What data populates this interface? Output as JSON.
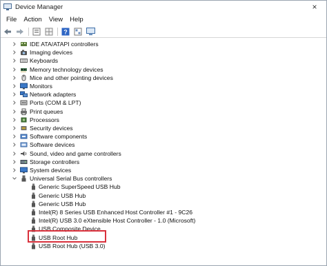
{
  "window": {
    "title": "Device Manager",
    "close_glyph": "×"
  },
  "menu": {
    "items": [
      "File",
      "Action",
      "View",
      "Help"
    ]
  },
  "toolbar": {
    "buttons": [
      "back-arrow-icon",
      "forward-arrow-icon",
      "properties-icon",
      "grid-icon",
      "help-icon",
      "view-icon",
      "monitor-icon"
    ]
  },
  "tree": {
    "categories": [
      {
        "label": "IDE ATA/ATAPI controllers",
        "icon": "ide-controller-icon",
        "expanded": false
      },
      {
        "label": "Imaging devices",
        "icon": "camera-icon",
        "expanded": false
      },
      {
        "label": "Keyboards",
        "icon": "keyboard-icon",
        "expanded": false
      },
      {
        "label": "Memory technology devices",
        "icon": "memory-icon",
        "expanded": false
      },
      {
        "label": "Mice and other pointing devices",
        "icon": "mouse-icon",
        "expanded": false
      },
      {
        "label": "Monitors",
        "icon": "monitor-icon",
        "expanded": false
      },
      {
        "label": "Network adapters",
        "icon": "network-icon",
        "expanded": false
      },
      {
        "label": "Ports (COM & LPT)",
        "icon": "port-icon",
        "expanded": false
      },
      {
        "label": "Print queues",
        "icon": "printer-icon",
        "expanded": false
      },
      {
        "label": "Processors",
        "icon": "processor-icon",
        "expanded": false
      },
      {
        "label": "Security devices",
        "icon": "security-icon",
        "expanded": false
      },
      {
        "label": "Software components",
        "icon": "software-component-icon",
        "expanded": false
      },
      {
        "label": "Software devices",
        "icon": "software-device-icon",
        "expanded": false
      },
      {
        "label": "Sound, video and game controllers",
        "icon": "sound-icon",
        "expanded": false
      },
      {
        "label": "Storage controllers",
        "icon": "storage-icon",
        "expanded": false
      },
      {
        "label": "System devices",
        "icon": "system-icon",
        "expanded": false
      },
      {
        "label": "Universal Serial Bus controllers",
        "icon": "usb-icon",
        "expanded": true
      }
    ],
    "usb_children": [
      "Generic SuperSpeed USB Hub",
      "Generic USB Hub",
      "Generic USB Hub",
      "Intel(R) 8 Series USB Enhanced Host Controller #1 - 9C26",
      "Intel(R) USB 3.0 eXtensible Host Controller - 1.0 (Microsoft)",
      "USB Composite Device",
      "USB Root Hub",
      "USB Root Hub (USB 3.0)"
    ],
    "highlighted_item": "USB Root Hub"
  },
  "colors": {
    "highlight": "#d9303b",
    "chevron": "#666666",
    "usb_plug": "#555555"
  }
}
